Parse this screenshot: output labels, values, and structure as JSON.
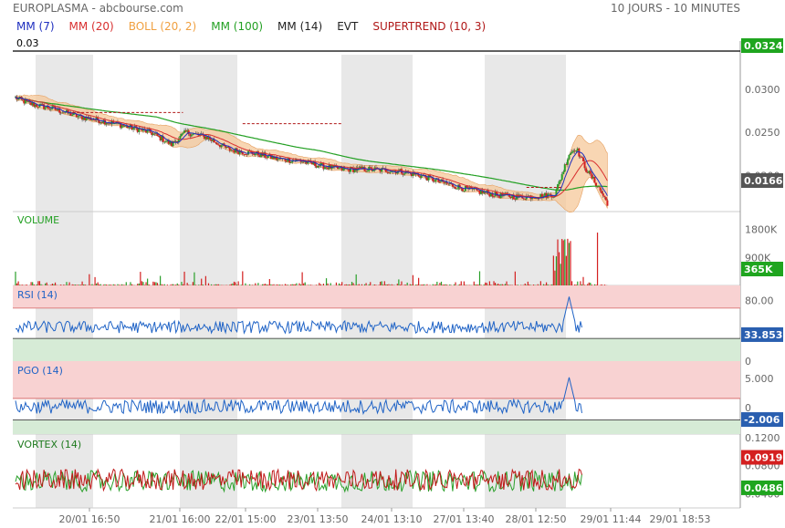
{
  "header": {
    "title": "EUROPLASMA - abcbourse.com",
    "range": "10 JOURS - 10 MINUTES"
  },
  "legend": [
    {
      "text": "MM (7)",
      "color": "#1f2fbf"
    },
    {
      "text": "MM (20)",
      "color": "#d83030"
    },
    {
      "text": "BOLL (20, 2)",
      "color": "#f0a040"
    },
    {
      "text": "MM (100)",
      "color": "#23a023"
    },
    {
      "text": "MM (14)",
      "color": "#222222"
    },
    {
      "text": "EVT",
      "color": "#222222"
    },
    {
      "text": "SUPERTREND (10, 3)",
      "color": "#b01818"
    }
  ],
  "colors": {
    "candle_up": "#2aa02a",
    "candle_down": "#d42020",
    "ma7": "#1f2fbf",
    "ma20": "#d83030",
    "ma100": "#23a023",
    "boll_fill": "#f6c89a",
    "session_shade": "#e8e8e8",
    "volume": "#d42020",
    "volume_up": "#2aa02a",
    "rsi_line": "#1f63c6",
    "pgo_line": "#1f63c6",
    "overbought": "#f8d2d2",
    "oversold": "#d6ebd6",
    "vortex_plus": "#2aa02a",
    "vortex_minus": "#c01818",
    "badge_green": "#1fa51f",
    "badge_red": "#d42020",
    "badge_black": "#000000",
    "badge_gray": "#555555",
    "badge_blue": "#2a5fb0"
  },
  "chart_data": [
    {
      "name": "price",
      "type": "candlestick",
      "ylim": [
        0.0158,
        0.034
      ],
      "yticks": [
        "0.0300",
        "0.0250",
        "0.0200"
      ],
      "ytick_values": [
        0.03,
        0.025,
        0.02
      ],
      "level_label": "0.03",
      "level_value": 0.03,
      "last_price": "0.0166",
      "level_badge": "0.0324",
      "xticks": [
        "20/01 16:50",
        "21/01 16:00",
        "22/01 15:00",
        "23/01 13:50",
        "24/01 13:10",
        "27/01 13:40",
        "28/01 12:50",
        "29/01 11:44",
        "29/01 18:53"
      ],
      "anchors": [
        [
          0,
          0.029
        ],
        [
          10,
          0.0283
        ],
        [
          25,
          0.0278
        ],
        [
          45,
          0.0268
        ],
        [
          65,
          0.0262
        ],
        [
          80,
          0.0256
        ],
        [
          95,
          0.025
        ],
        [
          110,
          0.0236
        ],
        [
          120,
          0.025
        ],
        [
          135,
          0.0244
        ],
        [
          150,
          0.023
        ],
        [
          170,
          0.0225
        ],
        [
          185,
          0.0219
        ],
        [
          200,
          0.0217
        ],
        [
          215,
          0.0211
        ],
        [
          230,
          0.0207
        ],
        [
          250,
          0.0207
        ],
        [
          270,
          0.0205
        ],
        [
          285,
          0.02
        ],
        [
          300,
          0.0192
        ],
        [
          320,
          0.0183
        ],
        [
          340,
          0.0177
        ],
        [
          355,
          0.0175
        ],
        [
          370,
          0.0176
        ],
        [
          380,
          0.0178
        ],
        [
          390,
          0.0225
        ],
        [
          395,
          0.0232
        ],
        [
          402,
          0.0207
        ],
        [
          410,
          0.0188
        ],
        [
          417,
          0.0168
        ]
      ]
    },
    {
      "name": "volume",
      "type": "bar",
      "ylim": [
        0,
        2200
      ],
      "yticks": [
        "1800K",
        "900K"
      ],
      "ytick_values": [
        1800,
        900
      ],
      "last": "365K"
    },
    {
      "name": "rsi",
      "type": "line",
      "ylim": [
        0,
        100
      ],
      "yticks": [
        "80.00",
        "0"
      ],
      "ytick_values": [
        80,
        0
      ],
      "bands": [
        70,
        30
      ],
      "last": "33.853",
      "label": "RSI (14)"
    },
    {
      "name": "pgo",
      "type": "line",
      "ylim": [
        -4.5,
        8
      ],
      "yticks": [
        "5.000",
        "0"
      ],
      "ytick_values": [
        5,
        0
      ],
      "bands": [
        1.6,
        -2.1
      ],
      "last": "-2.006",
      "label": "PGO (14)"
    },
    {
      "name": "vortex",
      "type": "line",
      "ylim": [
        0.02,
        0.125
      ],
      "yticks": [
        "0.1200",
        "0.0800",
        "0.0400"
      ],
      "ytick_values": [
        0.12,
        0.08,
        0.04
      ],
      "plus_last": "0.0486",
      "minus_last": "0.0919",
      "label": "VORTEX (14)"
    }
  ],
  "volume_label": "VOLUME"
}
